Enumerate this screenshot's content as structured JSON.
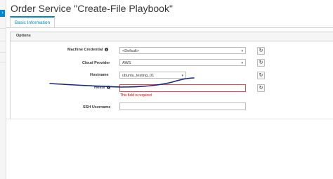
{
  "page": {
    "title": "Order Service \"Create-File Playbook\""
  },
  "left_strip": {
    "tab_glyph": "›"
  },
  "tabs": [
    {
      "label": "Basic Information",
      "active": true
    }
  ],
  "panel": {
    "title": "Options"
  },
  "form": {
    "machine_credential": {
      "label": "Machine Credential",
      "value": "<Default>"
    },
    "cloud_provider": {
      "label": "Cloud Provider",
      "value": "AWS"
    },
    "hostname": {
      "label": "Hostname",
      "value": "ubuntu_testing_01"
    },
    "hosts": {
      "label": "Hosts",
      "value": "",
      "error": "This field is required"
    },
    "ssh_username": {
      "label": "SSH Username",
      "value": ""
    }
  },
  "icons": {
    "info": "info-icon",
    "refresh": "refresh-icon",
    "caret": "caret-down-icon"
  },
  "colors": {
    "accent": "#0088ce",
    "error": "#e34b4b",
    "annotation": "#1a237e"
  }
}
